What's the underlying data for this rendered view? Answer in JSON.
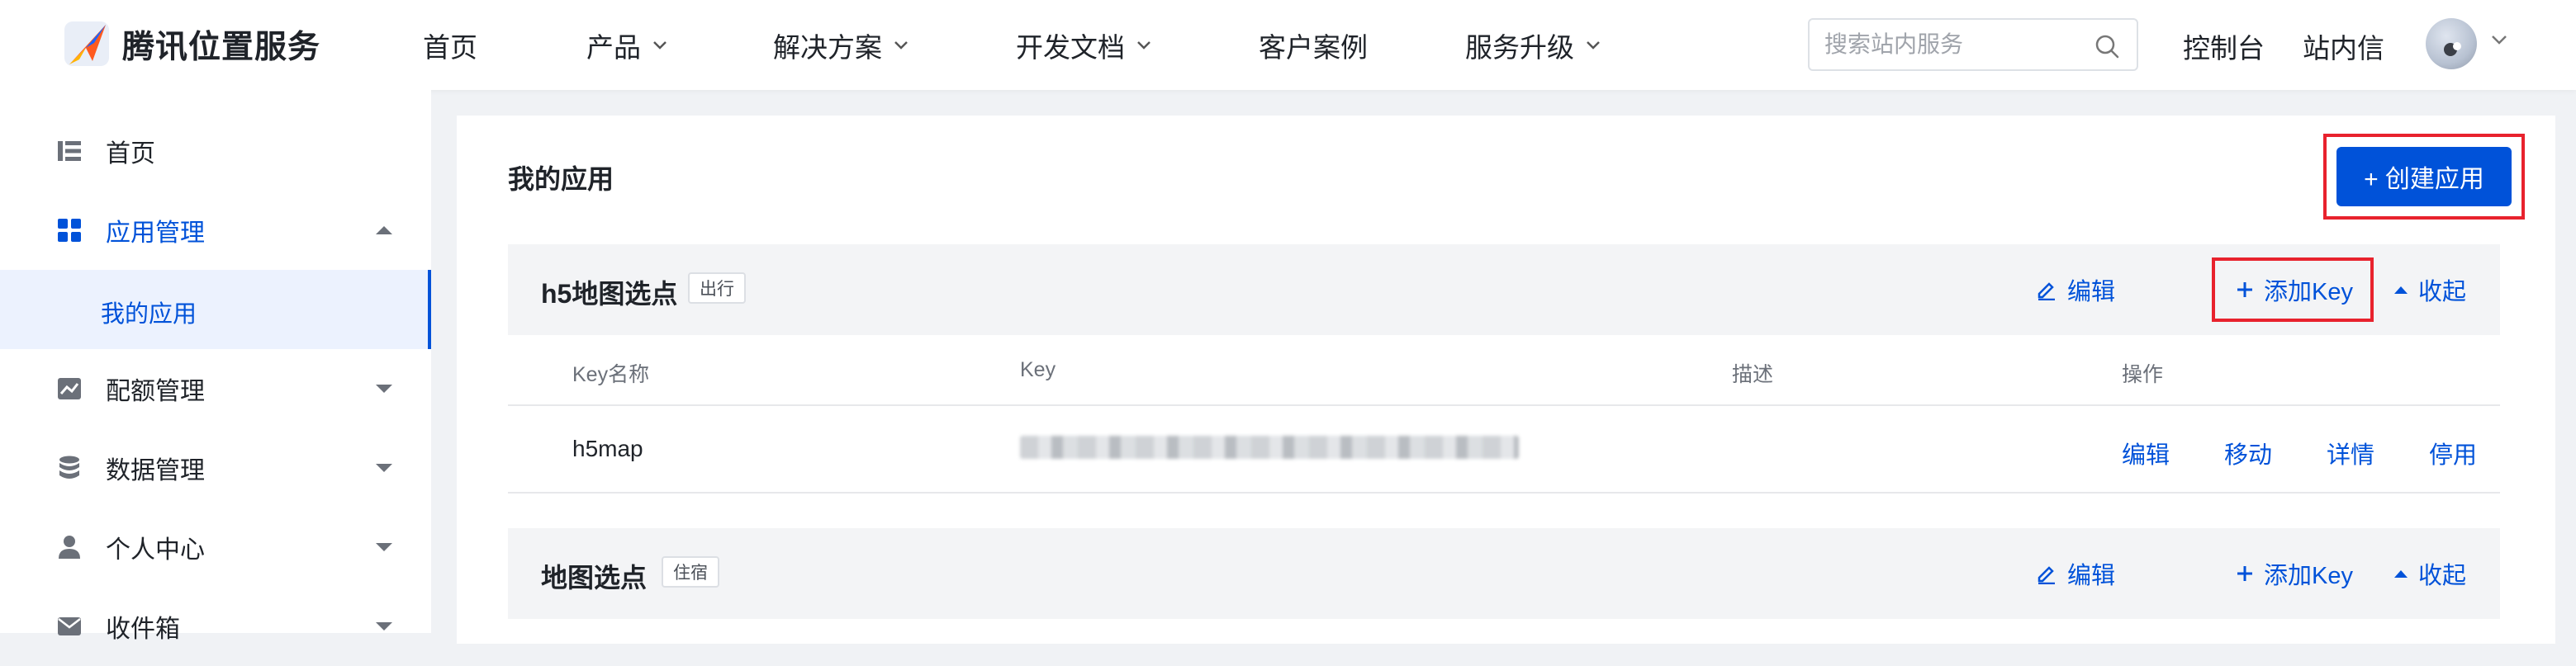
{
  "header": {
    "logo_text": "腾讯位置服务",
    "nav": [
      {
        "label": "首页",
        "has_dropdown": false
      },
      {
        "label": "产品",
        "has_dropdown": true
      },
      {
        "label": "解决方案",
        "has_dropdown": true
      },
      {
        "label": "开发文档",
        "has_dropdown": true
      },
      {
        "label": "客户案例",
        "has_dropdown": false
      },
      {
        "label": "服务升级",
        "has_dropdown": true
      }
    ],
    "search_placeholder": "搜索站内服务",
    "console_label": "控制台",
    "inbox_label": "站内信"
  },
  "sidebar": {
    "items": [
      {
        "label": "首页",
        "icon": "list-icon"
      },
      {
        "label": "应用管理",
        "icon": "grid-icon",
        "expanded": true
      },
      {
        "label": "配额管理",
        "icon": "chart-icon"
      },
      {
        "label": "数据管理",
        "icon": "database-icon"
      },
      {
        "label": "个人中心",
        "icon": "user-icon"
      },
      {
        "label": "收件箱",
        "icon": "mail-icon"
      }
    ],
    "sub_active": "我的应用"
  },
  "main": {
    "title": "我的应用",
    "create_button": "+ 创建应用",
    "apps": [
      {
        "name": "h5地图选点",
        "tag": "出行",
        "actions": {
          "edit": "编辑",
          "add_key": "添加Key",
          "collapse": "收起"
        },
        "columns": [
          "Key名称",
          "Key",
          "描述",
          "操作"
        ],
        "rows": [
          {
            "key_name": "h5map",
            "key": "",
            "description": "",
            "ops": [
              "编辑",
              "移动",
              "详情",
              "停用"
            ]
          }
        ]
      },
      {
        "name": "地图选点",
        "tag": "住宿",
        "actions": {
          "edit": "编辑",
          "add_key": "添加Key",
          "collapse": "收起"
        }
      }
    ]
  },
  "colors": {
    "brand": "#0052d9",
    "highlight": "#e8222d",
    "bg": "#f0f2f5"
  }
}
